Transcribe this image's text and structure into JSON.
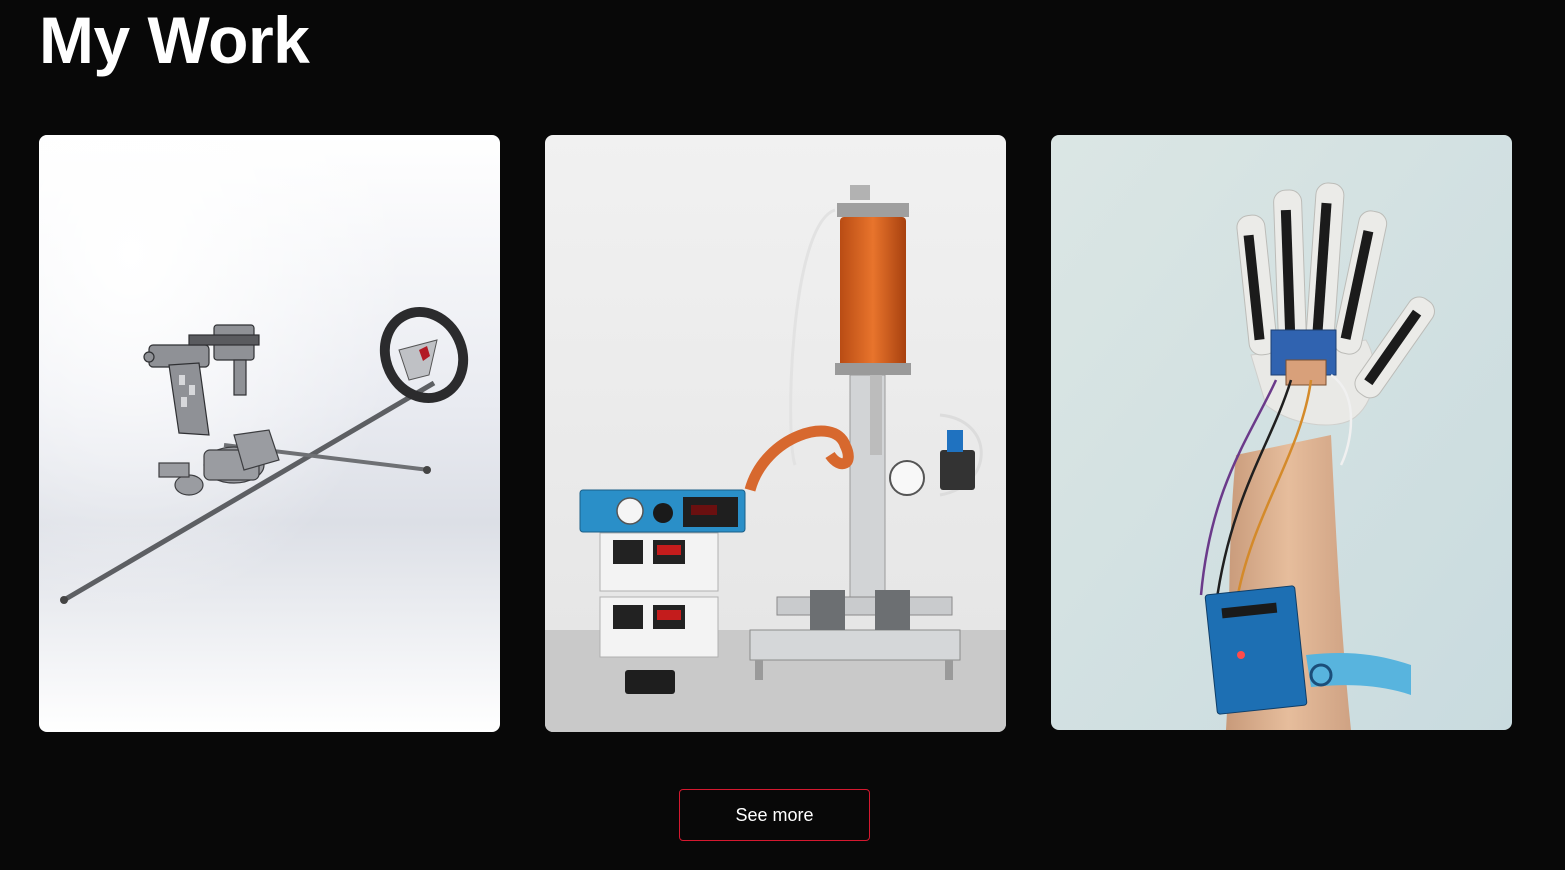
{
  "section": {
    "title": "My Work"
  },
  "projects": [
    {
      "image": "cad-steering-assembly-render"
    },
    {
      "image": "dispensing-machine-photo"
    },
    {
      "image": "sensor-glove-arduino-photo"
    }
  ],
  "actions": {
    "see_more_label": "See more"
  },
  "colors": {
    "background": "#080808",
    "accent_border": "#d5182f",
    "text": "#ffffff"
  }
}
